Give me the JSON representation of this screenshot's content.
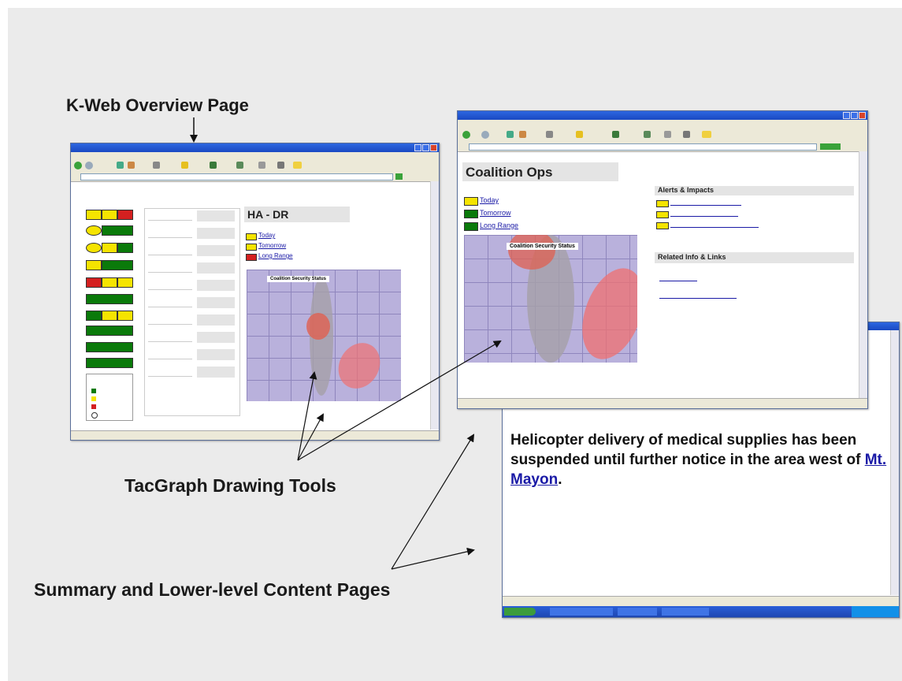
{
  "labels": {
    "overview": "K-Web Overview Page",
    "tacgraph": "TacGraph Drawing Tools",
    "summary": "Summary and Lower-level Content Pages"
  },
  "overview_window": {
    "page_title": "HA - DR",
    "links": [
      "Today",
      "Tomorrow",
      "Long Range"
    ],
    "map_caption": "Coalition Security Status"
  },
  "coalition_window": {
    "page_title": "Coalition Ops",
    "links": [
      "Today",
      "Tomorrow",
      "Long Range"
    ],
    "map_caption": "Coalition Security Status",
    "alerts_heading": "Alerts & Impacts",
    "related_heading": "Related Info & Links"
  },
  "summary_window": {
    "message": "Helicopter delivery of medical supplies has been suspended until further notice in the area west of",
    "link_text": "Mt. Mayon",
    "message_end": "."
  },
  "colors": {
    "accent_blue": "#1a49c2",
    "status_green": "#0a7a0a",
    "status_yellow": "#f5e400",
    "status_red": "#d42020",
    "map_purple": "#b9b1dc",
    "link_blue": "#1a1aa6"
  }
}
